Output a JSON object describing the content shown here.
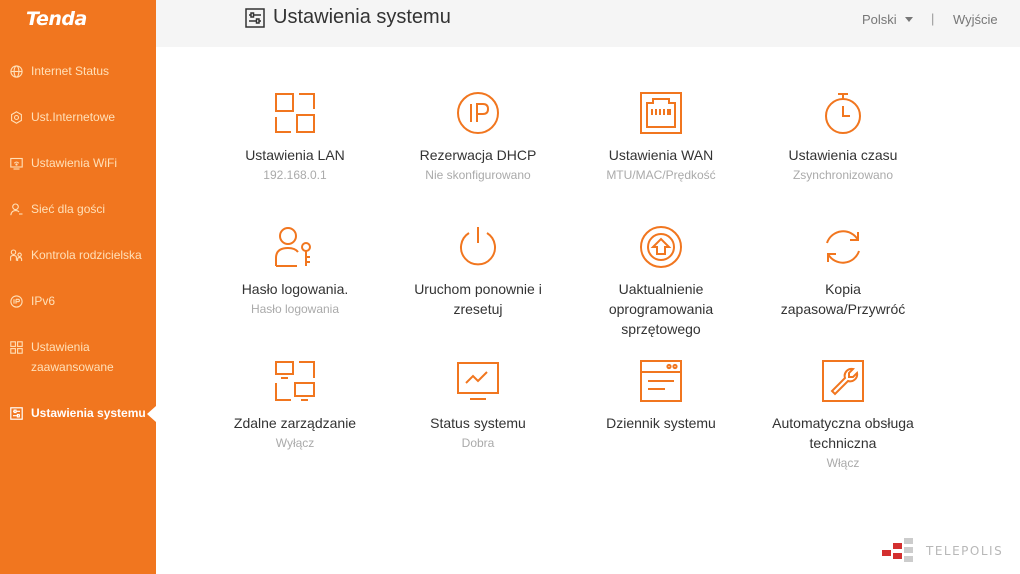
{
  "brand": {
    "logo_text": "Tenda",
    "accent": "#f1761f",
    "wordmark": "TELEPOLIS"
  },
  "sidebar": {
    "items": [
      {
        "label": "Internet Status",
        "icon": "globe-icon"
      },
      {
        "label": "Ust.Internetowe",
        "icon": "gear-icon"
      },
      {
        "label": "Ustawienia WiFi",
        "icon": "wifi-screen-icon"
      },
      {
        "label": "Sieć dla gości",
        "icon": "guest-user-icon"
      },
      {
        "label": "Kontrola rodzicielska",
        "icon": "parental-control-icon"
      },
      {
        "label": "IPv6",
        "icon": "ipv6-icon"
      },
      {
        "label": "Ustawienia zaawansowane",
        "icon": "grid-icon"
      },
      {
        "label": "Ustawienia systemu",
        "icon": "sliders-icon",
        "active": true
      }
    ]
  },
  "header": {
    "title": "Ustawienia systemu",
    "language": "Polski",
    "separator": "|",
    "logout": "Wyjście"
  },
  "tiles": [
    {
      "title": "Ustawienia LAN",
      "status": "192.168.0.1",
      "icon": "lan-icon"
    },
    {
      "title": "Rezerwacja DHCP",
      "status": "Nie skonfigurowano",
      "icon": "ip-icon"
    },
    {
      "title": "Ustawienia WAN",
      "status": "MTU/MAC/Prędkość",
      "icon": "ethernet-port-icon"
    },
    {
      "title": "Ustawienia czasu",
      "status": "Zsynchronizowano",
      "icon": "stopwatch-icon"
    },
    {
      "title": "Hasło logowania.",
      "status": "Hasło logowania",
      "icon": "user-key-icon"
    },
    {
      "title": "Uruchom ponownie i zresetuj",
      "status": "",
      "icon": "power-icon"
    },
    {
      "title": "Uaktualnienie oprogramowania sprzętowego",
      "status": "",
      "icon": "upgrade-icon"
    },
    {
      "title": "Kopia zapasowa/Przywróć",
      "status": "",
      "icon": "refresh-icon"
    },
    {
      "title": "Zdalne zarządzanie",
      "status": "Wyłącz",
      "icon": "remote-management-icon"
    },
    {
      "title": "Status systemu",
      "status": "Dobra",
      "icon": "monitor-chart-icon"
    },
    {
      "title": "Dziennik systemu",
      "status": "",
      "icon": "log-window-icon"
    },
    {
      "title": "Automatyczna obsługa techniczna",
      "status": "Włącz",
      "icon": "wrench-icon"
    }
  ]
}
